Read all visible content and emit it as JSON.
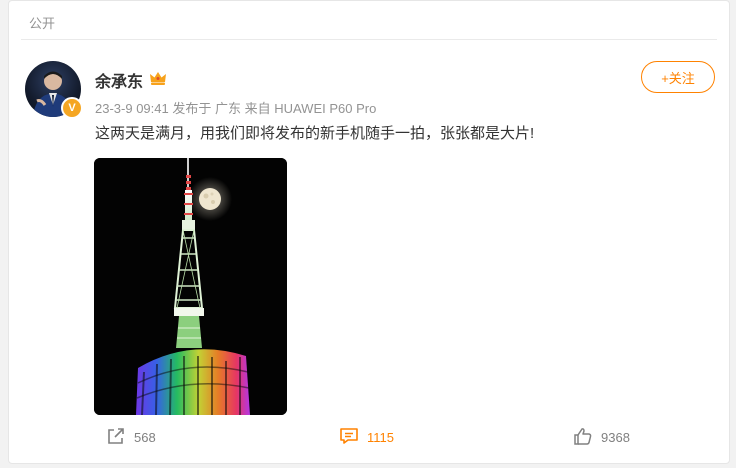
{
  "visibility_label": "公开",
  "post": {
    "author": "余承东",
    "date": "23-3-9 09:41",
    "location": "发布于 广东",
    "source": "来自 HUAWEI P60 Pro",
    "text": "这两天是满月，用我们即将发布的新手机随手一拍，张张都是大片!",
    "follow_label": "+关注",
    "verified_badge": "V"
  },
  "actions": {
    "repost_count": "568",
    "comment_count": "1115",
    "like_count": "9368"
  },
  "colors": {
    "accent": "#ff8200",
    "meta_text": "#939393"
  },
  "icons": [
    "crown-icon",
    "repost-icon",
    "comment-icon",
    "like-icon"
  ]
}
